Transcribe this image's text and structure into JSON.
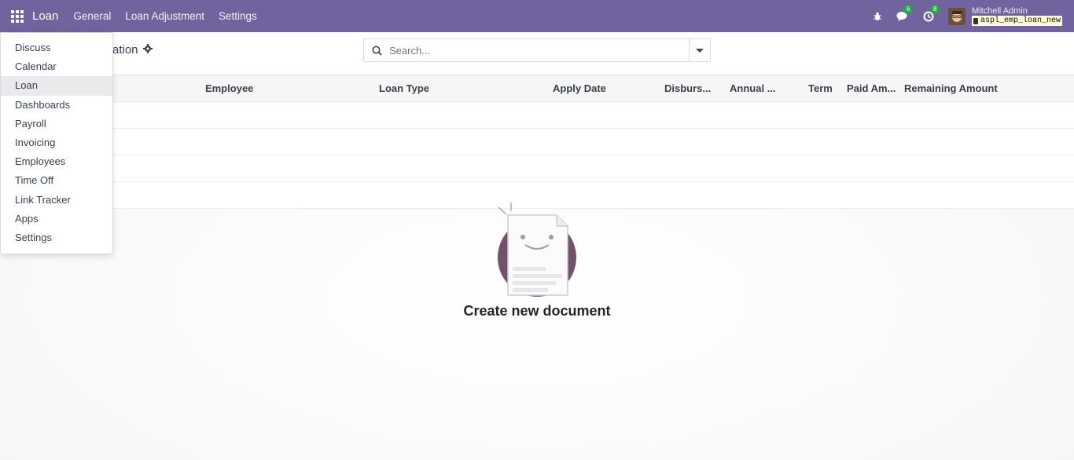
{
  "navbar": {
    "brand": "Loan",
    "menus": [
      "General",
      "Loan Adjustment",
      "Settings"
    ],
    "messages_count": "6",
    "activities_count": "8",
    "user_name": "Mitchell Admin",
    "database": "aspl_emp_loan_new",
    "color": "#71639e"
  },
  "control_panel": {
    "breadcrumb": "ation",
    "search_placeholder": "Search..."
  },
  "list": {
    "columns": [
      "Employee",
      "Loan Type",
      "Apply Date",
      "Disburs...",
      "Annual ...",
      "Term",
      "Paid Am...",
      "Remaining Amount"
    ]
  },
  "empty_state": {
    "title": "Create new document"
  },
  "apps_menu": {
    "items": [
      "Discuss",
      "Calendar",
      "Loan",
      "Dashboards",
      "Payroll",
      "Invoicing",
      "Employees",
      "Time Off",
      "Link Tracker",
      "Apps",
      "Settings"
    ],
    "active": "Loan"
  },
  "icons": {
    "apps": "apps-grid-icon",
    "bug": "bug-icon",
    "messages": "chat-icon",
    "activities": "clock-icon",
    "gear": "gear-icon",
    "search": "search-icon",
    "dropdown": "caret-down-icon"
  }
}
